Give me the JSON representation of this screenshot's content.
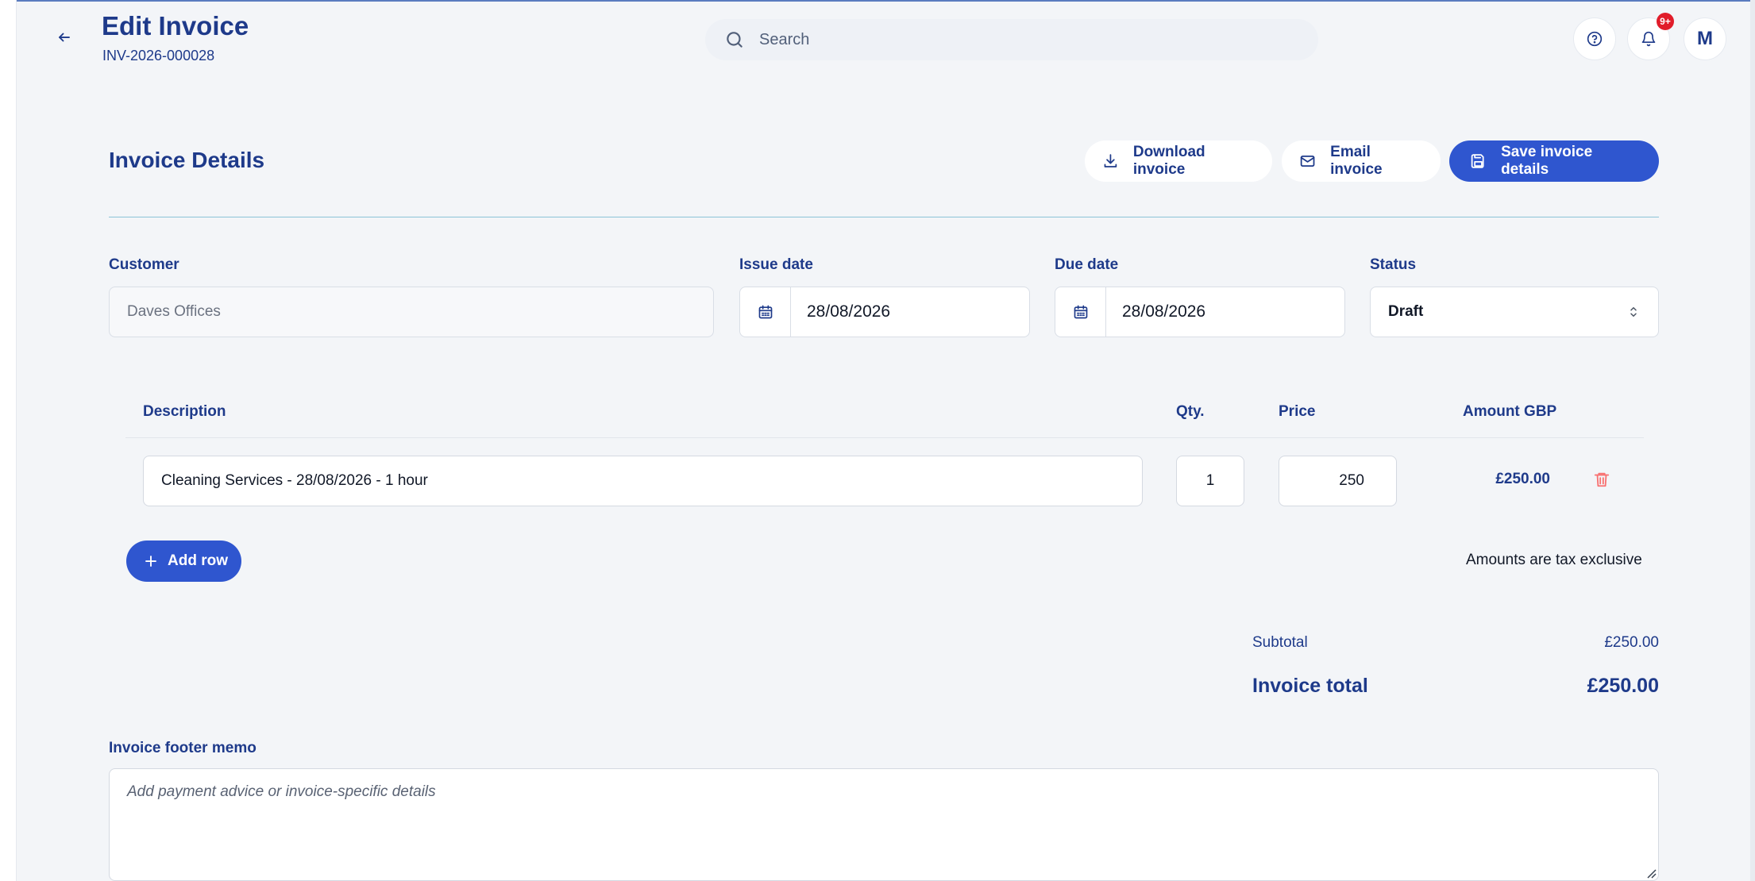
{
  "header": {
    "title": "Edit Invoice",
    "invoice_number": "INV-2026-000028",
    "search_placeholder": "Search",
    "notification_badge": "9+",
    "avatar_initial": "M"
  },
  "section": {
    "title": "Invoice Details",
    "download_label": "Download invoice",
    "email_label": "Email invoice",
    "save_label": "Save invoice details"
  },
  "form": {
    "customer_label": "Customer",
    "customer_value": "Daves Offices",
    "issue_date_label": "Issue date",
    "issue_date_value": "28/08/2026",
    "due_date_label": "Due date",
    "due_date_value": "28/08/2026",
    "status_label": "Status",
    "status_value": "Draft"
  },
  "table": {
    "headers": {
      "description": "Description",
      "qty": "Qty.",
      "price": "Price",
      "amount": "Amount GBP"
    },
    "rows": [
      {
        "description": "Cleaning Services - 28/08/2026 - 1 hour",
        "qty": "1",
        "price": "250",
        "amount": "£250.00"
      }
    ],
    "add_row_label": "Add row",
    "tax_note": "Amounts are tax exclusive"
  },
  "totals": {
    "subtotal_label": "Subtotal",
    "subtotal_value": "£250.00",
    "total_label": "Invoice total",
    "total_value": "£250.00"
  },
  "memo": {
    "label": "Invoice footer memo",
    "placeholder": "Add payment advice or invoice-specific details"
  },
  "colors": {
    "primary": "#2f56cf",
    "text_navy": "#1e3a8a",
    "badge_red": "#e11d2a",
    "delete_red": "#f87171"
  }
}
